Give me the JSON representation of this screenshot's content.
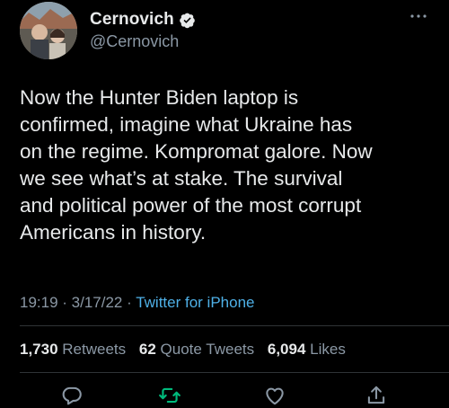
{
  "author": {
    "display_name": "Cernovich",
    "handle": "@Cernovich"
  },
  "tweet": {
    "lines": [
      "Now the Hunter Biden laptop is",
      "confirmed, imagine what Ukraine has",
      "on the regime. Kompromat galore. Now",
      "we see what’s at stake. The survival",
      "and political power of the most corrupt",
      "Americans in history."
    ],
    "time": "19:19",
    "date": "3/17/22",
    "source": "Twitter for iPhone",
    "separator": " · "
  },
  "stats": {
    "retweets_count": "1,730",
    "retweets_label": "Retweets",
    "quotes_count": "62",
    "quotes_label": "Quote Tweets",
    "likes_count": "6,094",
    "likes_label": "Likes"
  },
  "icons": {
    "more": "more-icon",
    "verified": "verified-badge-icon",
    "reply": "reply-icon",
    "retweet": "retweet-icon",
    "like": "like-icon",
    "share": "share-icon"
  },
  "colors": {
    "background": "#000000",
    "text": "#e7e9ea",
    "secondary": "#8b98a5",
    "link": "#4fb1e8",
    "retweet_green": "#00ba7c",
    "divider": "#2f3336"
  }
}
